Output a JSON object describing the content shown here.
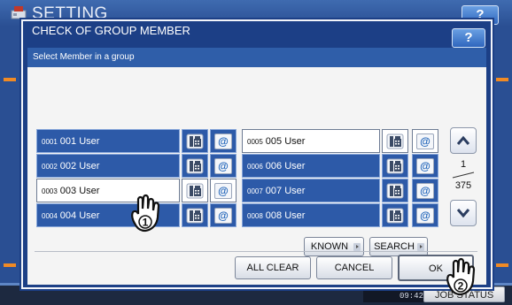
{
  "background_window": {
    "title": "SETTING",
    "help_label": "?",
    "clock": "09:42",
    "job_status_label": "JOB STATUS"
  },
  "dialog": {
    "title": "CHECK OF GROUP MEMBER",
    "help_label": "?",
    "subtitle": "Select Member in a group"
  },
  "members_left": [
    {
      "num": "0001",
      "name": "001 User",
      "selected": false
    },
    {
      "num": "0002",
      "name": "002 User",
      "selected": false
    },
    {
      "num": "0003",
      "name": "003 User",
      "selected": true
    },
    {
      "num": "0004",
      "name": "004 User",
      "selected": false
    }
  ],
  "members_right": [
    {
      "num": "0005",
      "name": "005 User",
      "selected": true
    },
    {
      "num": "0006",
      "name": "006 User",
      "selected": false
    },
    {
      "num": "0007",
      "name": "007 User",
      "selected": false
    },
    {
      "num": "0008",
      "name": "008 User",
      "selected": false
    }
  ],
  "pager": {
    "current_page": "1",
    "total_pages": "375"
  },
  "buttons": {
    "known_id": "KNOWN ID",
    "search": "SEARCH",
    "all_clear": "ALL CLEAR",
    "cancel": "CANCEL",
    "ok": "OK"
  },
  "callouts": {
    "step1": "1",
    "step2": "2"
  },
  "icons": {
    "fax": "fax-icon",
    "email": "email-icon",
    "up": "chevron-up-icon",
    "down": "chevron-down-icon"
  },
  "colors": {
    "dialog_frame": "#1c3f86",
    "row_blue": "#2d5aa8",
    "header_blue": "#2f5ea9",
    "accent_orange": "#f08a24"
  }
}
